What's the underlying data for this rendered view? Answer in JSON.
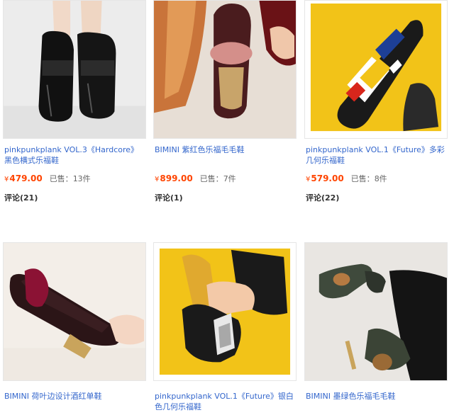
{
  "products": [
    {
      "title": "pinkpunkplank VOL.3《Hardcore》黑色横式乐福鞋",
      "currency": "¥",
      "price": "479.00",
      "sold_label": "已售：",
      "sold_count": "13件",
      "reviews_label": "评论",
      "reviews_count": "(21)"
    },
    {
      "title": "BIMINI 紫红色乐福毛毛鞋",
      "currency": "¥",
      "price": "899.00",
      "sold_label": "已售：",
      "sold_count": "7件",
      "reviews_label": "评论",
      "reviews_count": "(1)"
    },
    {
      "title": "pinkpunkplank VOL.1《Future》多彩几何乐福鞋",
      "currency": "¥",
      "price": "579.00",
      "sold_label": "已售：",
      "sold_count": "8件",
      "reviews_label": "评论",
      "reviews_count": "(22)"
    },
    {
      "title": "BIMINI 荷叶边设计酒红单鞋"
    },
    {
      "title": "pinkpunkplank VOL.1《Future》银白色几何乐福鞋"
    },
    {
      "title": "BIMINI 墨绿色乐福毛毛鞋"
    }
  ],
  "colors": {
    "link": "#3366cc",
    "price": "#ff4400",
    "yellow_bg": "#f2c318"
  }
}
